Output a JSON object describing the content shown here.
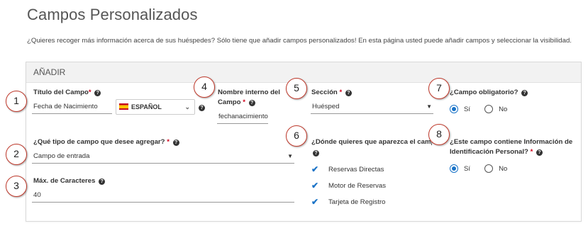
{
  "page": {
    "title": "Campos Personalizados",
    "intro": "¿Quieres recoger más información acerca de sus huéspedes? Sólo tiene que añadir campos personalizados! En esta página usted puede añadir campos y seleccionar la visibilidad."
  },
  "panel": {
    "header": "AÑADIR"
  },
  "field_title": {
    "label": "Título del Campo",
    "required_mark": "*",
    "value": "Fecha de Nacimiento",
    "language": "ESPAÑOL",
    "help_icon": "question-circle-icon"
  },
  "internal_name": {
    "label_line1": "Nombre interno del",
    "label_line2": "Campo",
    "required_mark": "*",
    "value": "fechanacimiento"
  },
  "section": {
    "label": "Sección",
    "required_mark": "*",
    "value": "Huésped"
  },
  "required_field": {
    "label": "¿Campo obligatorio?",
    "options": [
      "Sí",
      "No"
    ],
    "selected": "Sí"
  },
  "field_type": {
    "label": "¿Qué tipo de campo que desee agregar?",
    "required_mark": "*",
    "value": "Campo de entrada"
  },
  "where_appear": {
    "label": "¿Dónde quieres que aparezca el campo?",
    "items": [
      "Reservas Directas",
      "Motor de Reservas",
      "Tarjeta de Registro"
    ]
  },
  "personal_info": {
    "label_line1": "¿Este campo contiene Información de",
    "label_line2": "Identificación Personal?",
    "required_mark": "*",
    "options": [
      "Sí",
      "No"
    ],
    "selected": "Sí"
  },
  "max_chars": {
    "label": "Máx. de Caracteres",
    "value": "40"
  },
  "callouts": [
    "1",
    "2",
    "3",
    "4",
    "5",
    "6",
    "7",
    "8"
  ],
  "colors": {
    "accent": "#1a73c7",
    "required": "#d0021b",
    "callout_border": "#c0392b"
  }
}
